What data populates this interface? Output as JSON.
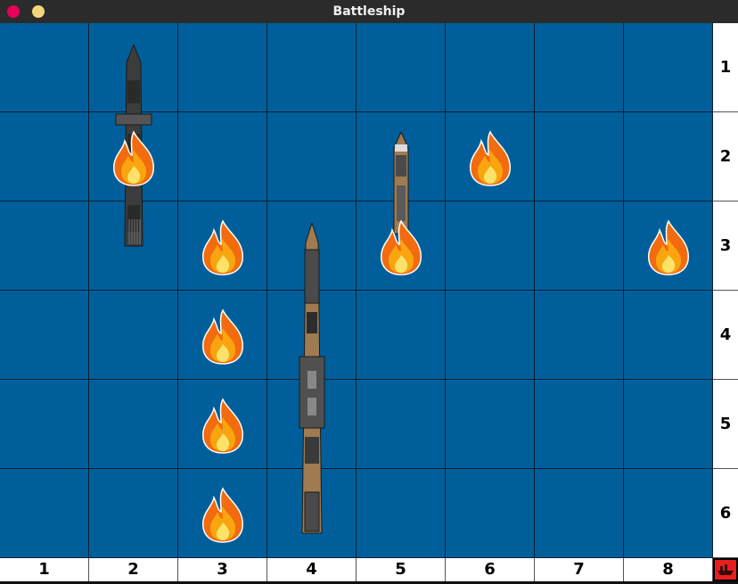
{
  "window": {
    "title": "Battleship"
  },
  "board": {
    "columns": [
      "1",
      "2",
      "3",
      "4",
      "5",
      "6",
      "7",
      "8"
    ],
    "rows": [
      "1",
      "2",
      "3",
      "4",
      "5",
      "6"
    ],
    "hits": [
      {
        "col": 2,
        "row": 2
      },
      {
        "col": 6,
        "row": 2
      },
      {
        "col": 3,
        "row": 3
      },
      {
        "col": 5,
        "row": 3
      },
      {
        "col": 8,
        "row": 3
      },
      {
        "col": 3,
        "row": 4
      },
      {
        "col": 3,
        "row": 5
      },
      {
        "col": 3,
        "row": 6
      }
    ],
    "ships": [
      {
        "name": "gray-warship",
        "col": 2,
        "row_start": 1,
        "row_end": 3
      },
      {
        "name": "battleship",
        "col": 4,
        "row_start": 3,
        "row_end": 6
      },
      {
        "name": "patrol-boat",
        "col": 5,
        "row_start": 2,
        "row_end": 3
      }
    ]
  },
  "corner_icon": "ship-icon",
  "colors": {
    "sea": "#005f9b",
    "grid": "#0a1f33",
    "corner": "#e81e1e"
  }
}
